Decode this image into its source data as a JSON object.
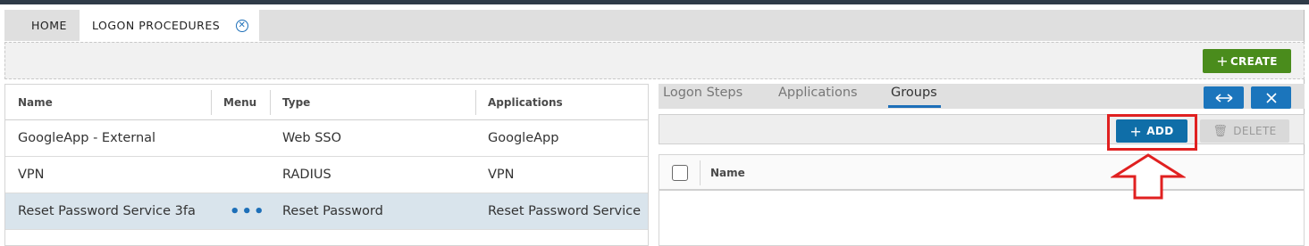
{
  "tabs": [
    {
      "label": "HOME"
    },
    {
      "label": "LOGON PROCEDURES",
      "close_icon": "close-circle-icon"
    }
  ],
  "toolbar": {
    "create_label": "CREATE"
  },
  "procedures_grid": {
    "columns": [
      "Name",
      "Menu",
      "Type",
      "Applications"
    ],
    "rows": [
      {
        "name": "GoogleApp - External",
        "menu": "",
        "type": "Web SSO",
        "applications": "GoogleApp"
      },
      {
        "name": "VPN",
        "menu": "",
        "type": "RADIUS",
        "applications": "VPN"
      },
      {
        "name": "Reset Password Service 3fa",
        "menu": "•••",
        "type": "Reset Password",
        "applications": "Reset Password Service",
        "selected": true
      }
    ]
  },
  "detail_panel": {
    "tabs": [
      "Logon Steps",
      "Applications",
      "Groups"
    ],
    "active_tab": "Groups",
    "expand_icon": "expand-horizontal-icon",
    "close_icon": "close-icon",
    "add_label": "ADD",
    "delete_label": "DELETE",
    "groups_grid": {
      "columns": [
        "Name"
      ]
    }
  },
  "annotation": {
    "highlight_color": "#e02020"
  },
  "colors": {
    "create": "#4a8c1c",
    "primary": "#1b75bc",
    "selected_row": "#d9e4ec"
  }
}
